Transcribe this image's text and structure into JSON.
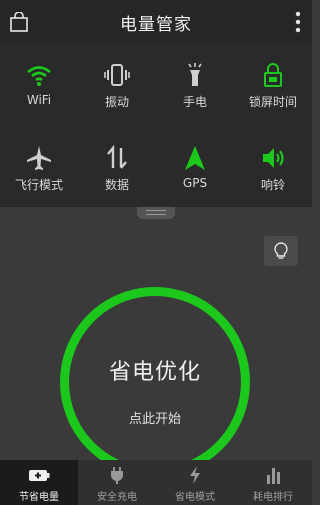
{
  "header": {
    "title": "电量管家"
  },
  "toggles": [
    {
      "label": "WiFi",
      "icon": "wifi-icon",
      "active": true
    },
    {
      "label": "振动",
      "icon": "vibrate-icon",
      "active": false
    },
    {
      "label": "手电",
      "icon": "flashlight-icon",
      "active": false
    },
    {
      "label": "锁屏时间",
      "icon": "lock-timer-icon",
      "active": true
    },
    {
      "label": "飞行模式",
      "icon": "airplane-icon",
      "active": false
    },
    {
      "label": "数据",
      "icon": "data-icon",
      "active": false
    },
    {
      "label": "GPS",
      "icon": "gps-icon",
      "active": true
    },
    {
      "label": "响铃",
      "icon": "ringer-icon",
      "active": true
    }
  ],
  "optimize": {
    "title": "省电优化",
    "action": "点此开始"
  },
  "nav": [
    {
      "label": "节省电量",
      "icon": "battery-icon",
      "active": true
    },
    {
      "label": "安全充电",
      "icon": "plug-icon",
      "active": false
    },
    {
      "label": "省电模式",
      "icon": "bolt-icon",
      "active": false
    },
    {
      "label": "耗电排行",
      "icon": "bar-chart-icon",
      "active": false
    }
  ],
  "colors": {
    "accent": "#1cc81c",
    "inactive": "#cfcfcf"
  }
}
